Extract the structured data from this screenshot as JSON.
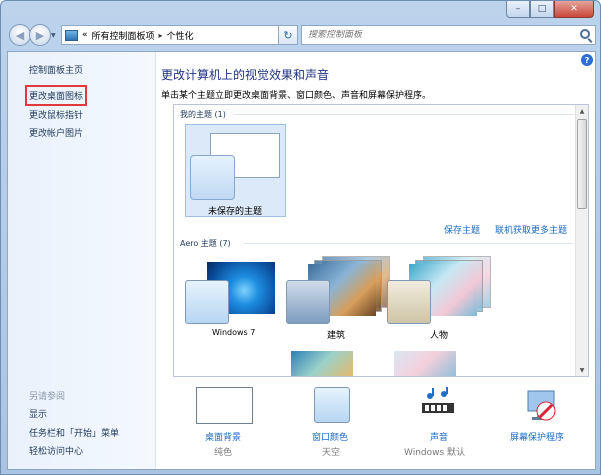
{
  "window": {
    "caption": {
      "minimize": "–",
      "maximize": "□",
      "close": "✕"
    }
  },
  "address": {
    "root": "«",
    "segments": [
      "所有控制面板项",
      "个性化"
    ],
    "separator": "▸"
  },
  "search": {
    "placeholder": "搜索控制面板"
  },
  "sidebar": {
    "links": [
      "控制面板主页",
      "更改桌面图标",
      "更改鼠标指针",
      "更改帐户图片"
    ],
    "see_also_heading": "另请参阅",
    "see_also": [
      "显示",
      "任务栏和「开始」菜单",
      "轻松访问中心"
    ]
  },
  "main": {
    "title": "更改计算机上的视觉效果和声音",
    "description": "单击某个主题立即更改桌面背景、窗口颜色、声音和屏幕保护程序。",
    "help": "?"
  },
  "themes": {
    "my_themes_label": "我的主题 (1)",
    "unsaved_name": "未保存的主题",
    "save_link": "保存主题",
    "online_link": "联机获取更多主题",
    "aero_label": "Aero 主题 (7)",
    "aero": [
      {
        "name": "Windows 7"
      },
      {
        "name": "建筑"
      },
      {
        "name": "人物"
      }
    ]
  },
  "bottom": [
    {
      "label": "桌面背景",
      "sub": "纯色"
    },
    {
      "label": "窗口颜色",
      "sub": "天空"
    },
    {
      "label": "声音",
      "sub": "Windows 默认"
    },
    {
      "label": "屏幕保护程序",
      "sub": ""
    }
  ],
  "colors": {
    "link": "#1a6ac5",
    "title": "#1e3287",
    "highlight": "#e0393e"
  }
}
